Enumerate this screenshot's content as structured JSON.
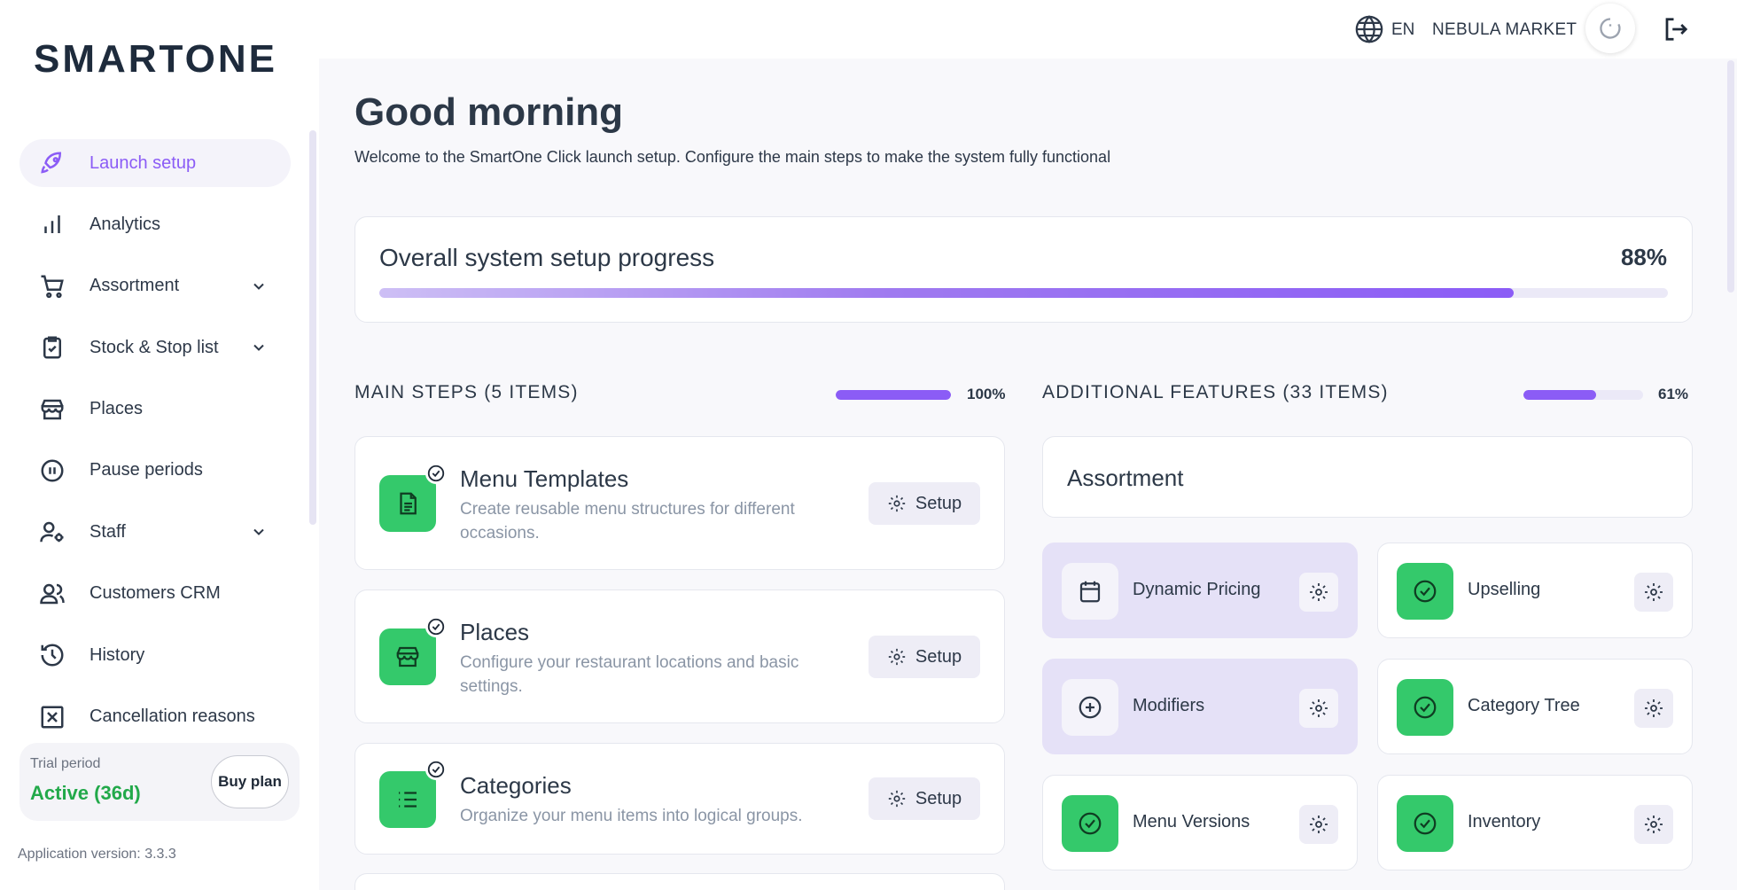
{
  "brand": {
    "logo_text": "SMARTONE"
  },
  "sidebar": {
    "items": [
      {
        "label": "Launch setup",
        "icon": "rocket-icon",
        "active": true
      },
      {
        "label": "Analytics",
        "icon": "bar-chart-icon"
      },
      {
        "label": "Assortment",
        "icon": "cart-icon",
        "has_chevron": true
      },
      {
        "label": "Stock & Stop list",
        "icon": "clipboard-check-icon",
        "has_chevron": true
      },
      {
        "label": "Places",
        "icon": "store-icon"
      },
      {
        "label": "Pause periods",
        "icon": "pause-circle-icon"
      },
      {
        "label": "Staff",
        "icon": "user-gear-icon",
        "has_chevron": true
      },
      {
        "label": "Customers CRM",
        "icon": "users-icon"
      },
      {
        "label": "History",
        "icon": "history-icon"
      },
      {
        "label": "Cancellation reasons",
        "icon": "x-square-icon"
      }
    ],
    "trial": {
      "label": "Trial period",
      "status": "Active (36d)",
      "buy_label": "Buy plan"
    },
    "app_version": "Application version: 3.3.3"
  },
  "topbar": {
    "language": "EN",
    "store_name": "NEBULA MARKET"
  },
  "main": {
    "greeting": "Good morning",
    "welcome": "Welcome to the SmartOne Click launch setup. Configure the main steps to make the system fully functional",
    "overall": {
      "title": "Overall system setup progress",
      "percent_label": "88%",
      "progress": 0.88
    },
    "main_steps": {
      "title": "MAIN STEPS (5 ITEMS)",
      "percent_label": "100%",
      "progress": 1.0,
      "items": [
        {
          "title": "Menu Templates",
          "desc": "Create reusable menu structures for different occasions.",
          "icon": "document-icon",
          "button": "Setup"
        },
        {
          "title": "Places",
          "desc": "Configure your restaurant locations and basic settings.",
          "icon": "store-icon",
          "button": "Setup"
        },
        {
          "title": "Categories",
          "desc": "Organize your menu items into logical groups.",
          "icon": "list-icon",
          "button": "Setup"
        }
      ]
    },
    "additional": {
      "title": "ADDITIONAL FEATURES (33 ITEMS)",
      "percent_label": "61%",
      "progress": 0.61,
      "group_title": "Assortment",
      "items": [
        {
          "label": "Dynamic Pricing",
          "status": "pending",
          "icon": "calendar-icon"
        },
        {
          "label": "Upselling",
          "status": "done",
          "icon": "check-circle-icon"
        },
        {
          "label": "Modifiers",
          "status": "pending",
          "icon": "plus-circle-icon"
        },
        {
          "label": "Category Tree",
          "status": "done",
          "icon": "check-circle-icon"
        },
        {
          "label": "Menu Versions",
          "status": "done",
          "icon": "check-circle-icon"
        },
        {
          "label": "Inventory",
          "status": "done",
          "icon": "check-circle-icon"
        }
      ]
    }
  },
  "colors": {
    "accent": "#8b5cf6",
    "success": "#34c96b",
    "pending_bg": "#e5e1f7",
    "trial_green": "#22a94a"
  }
}
